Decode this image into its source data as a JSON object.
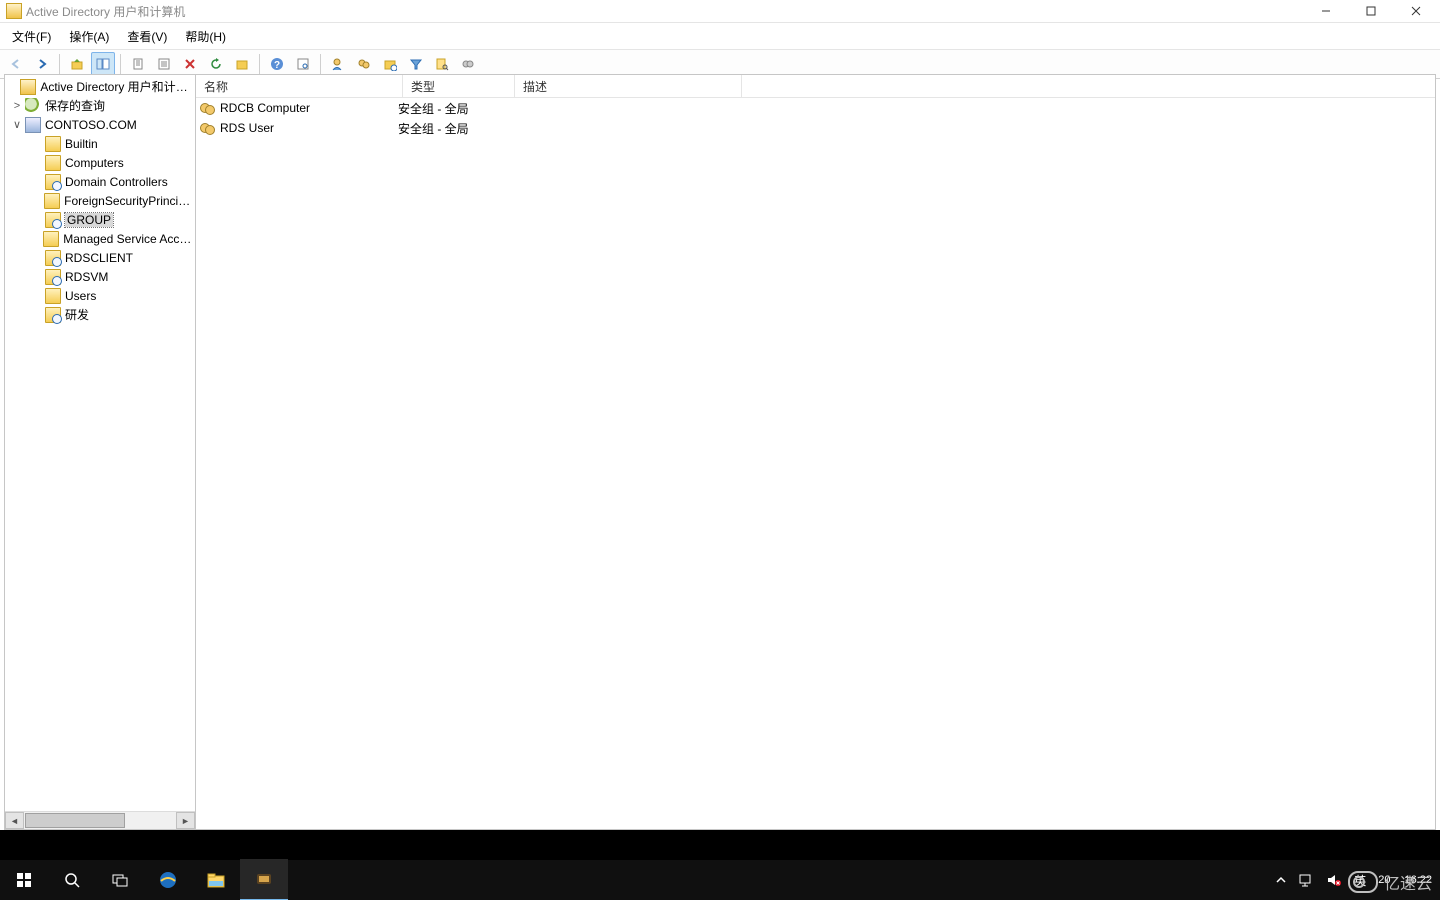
{
  "window": {
    "title": "Active Directory 用户和计算机"
  },
  "menu": {
    "file": "文件(F)",
    "action": "操作(A)",
    "view": "查看(V)",
    "help": "帮助(H)"
  },
  "tree": {
    "root": "Active Directory 用户和计算机",
    "saved_queries": "保存的查询",
    "domain": "CONTOSO.COM",
    "nodes": {
      "builtin": "Builtin",
      "computers": "Computers",
      "domain_controllers": "Domain Controllers",
      "fsp": "ForeignSecurityPrincipals",
      "group": "GROUP",
      "msa": "Managed Service Accounts",
      "rdsclient": "RDSCLIENT",
      "rdsvm": "RDSVM",
      "users": "Users",
      "yanfa": "研发"
    }
  },
  "columns": {
    "name": "名称",
    "type": "类型",
    "desc": "描述"
  },
  "column_widths": {
    "name": 190,
    "type": 95,
    "desc": 210
  },
  "rows": [
    {
      "name": "RDCB Computer",
      "type": "安全组 - 全局",
      "desc": ""
    },
    {
      "name": "RDS User",
      "type": "安全组 - 全局",
      "desc": ""
    }
  ],
  "tray": {
    "ime": "英",
    "ime2": "20",
    "time": "16:22"
  },
  "watermark": "亿速云"
}
